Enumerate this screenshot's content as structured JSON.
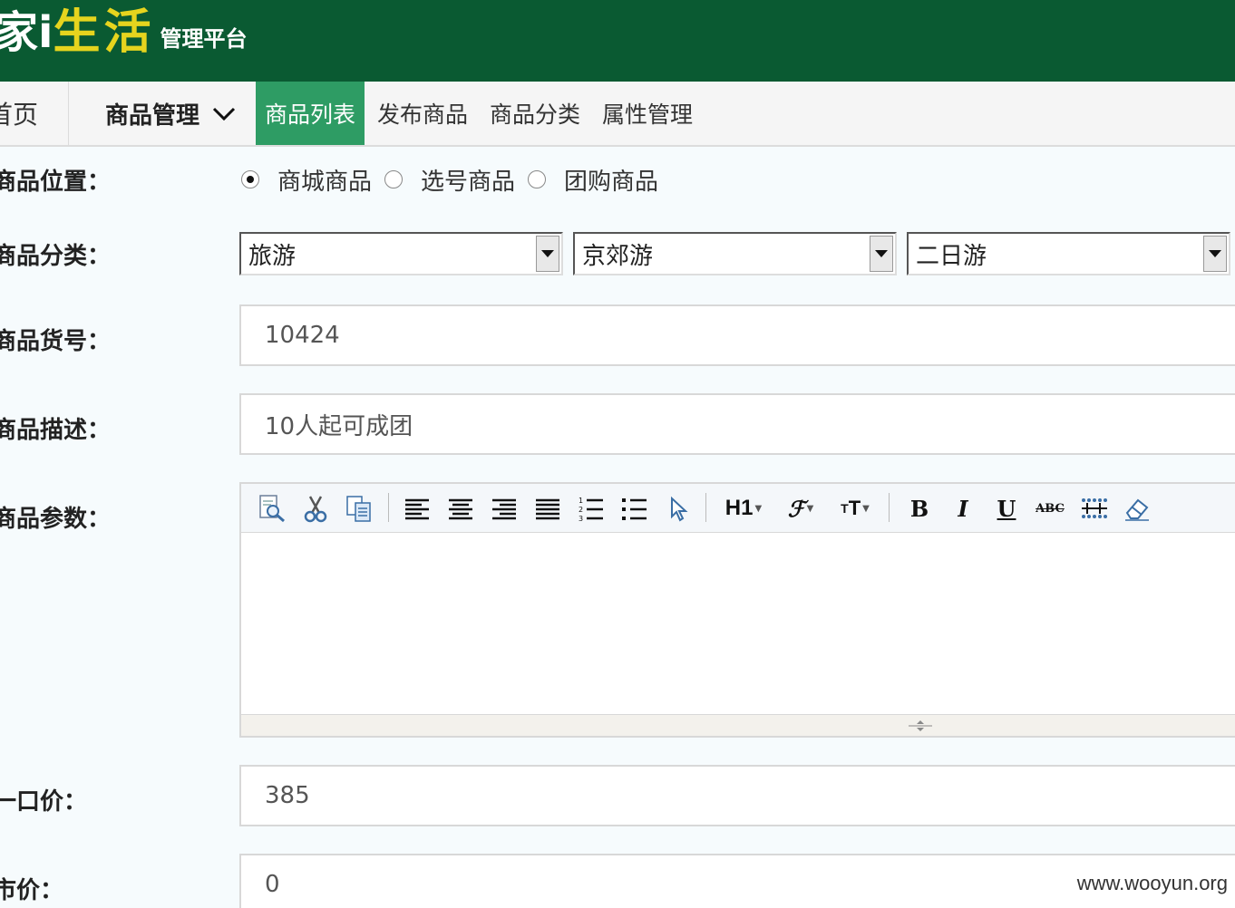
{
  "header": {
    "logo_part1": "家",
    "logo_part2": "i",
    "logo_part3": "生活",
    "logo_subtitle": "管理平台"
  },
  "nav": {
    "home": "首页",
    "menu": "商品管理",
    "tabs": [
      {
        "label": "商品列表",
        "active": true
      },
      {
        "label": "发布商品",
        "active": false
      },
      {
        "label": "商品分类",
        "active": false
      },
      {
        "label": "属性管理",
        "active": false
      }
    ]
  },
  "form": {
    "position_label": "商品位置：",
    "position_options": [
      {
        "label": "商城商品",
        "checked": true
      },
      {
        "label": "选号商品",
        "checked": false
      },
      {
        "label": "团购商品",
        "checked": false
      }
    ],
    "category_label": "商品分类：",
    "category_selects": [
      "旅游",
      "京郊游",
      "二日游"
    ],
    "sku_label": "商品货号：",
    "sku_value": "10424",
    "desc_label": "商品描述：",
    "desc_value": "10人起可成团",
    "params_label": "商品参数：",
    "price_label": "一口价：",
    "price_value": "385",
    "extra_label": "市价：",
    "extra_value": "0"
  },
  "editor": {
    "toolbar_icons": [
      "preview-icon",
      "cut-icon",
      "copy-icon",
      "align-left-icon",
      "align-center-icon",
      "align-right-icon",
      "align-justify-icon",
      "ordered-list-icon",
      "unordered-list-icon",
      "select-all-icon",
      "heading-icon",
      "font-family-icon",
      "font-size-icon",
      "bold-icon",
      "italic-icon",
      "underline-icon",
      "strikethrough-icon",
      "line-height-icon",
      "eraser-icon"
    ],
    "heading_text": "H1",
    "bold_text": "B",
    "italic_text": "I",
    "underline_text": "U",
    "strike_text": "ABC"
  },
  "watermark": "www.wooyun.org",
  "colors": {
    "header_bg": "#0a5a32",
    "active_tab_bg": "#2e9c64",
    "logo_accent": "#e6d41e"
  }
}
